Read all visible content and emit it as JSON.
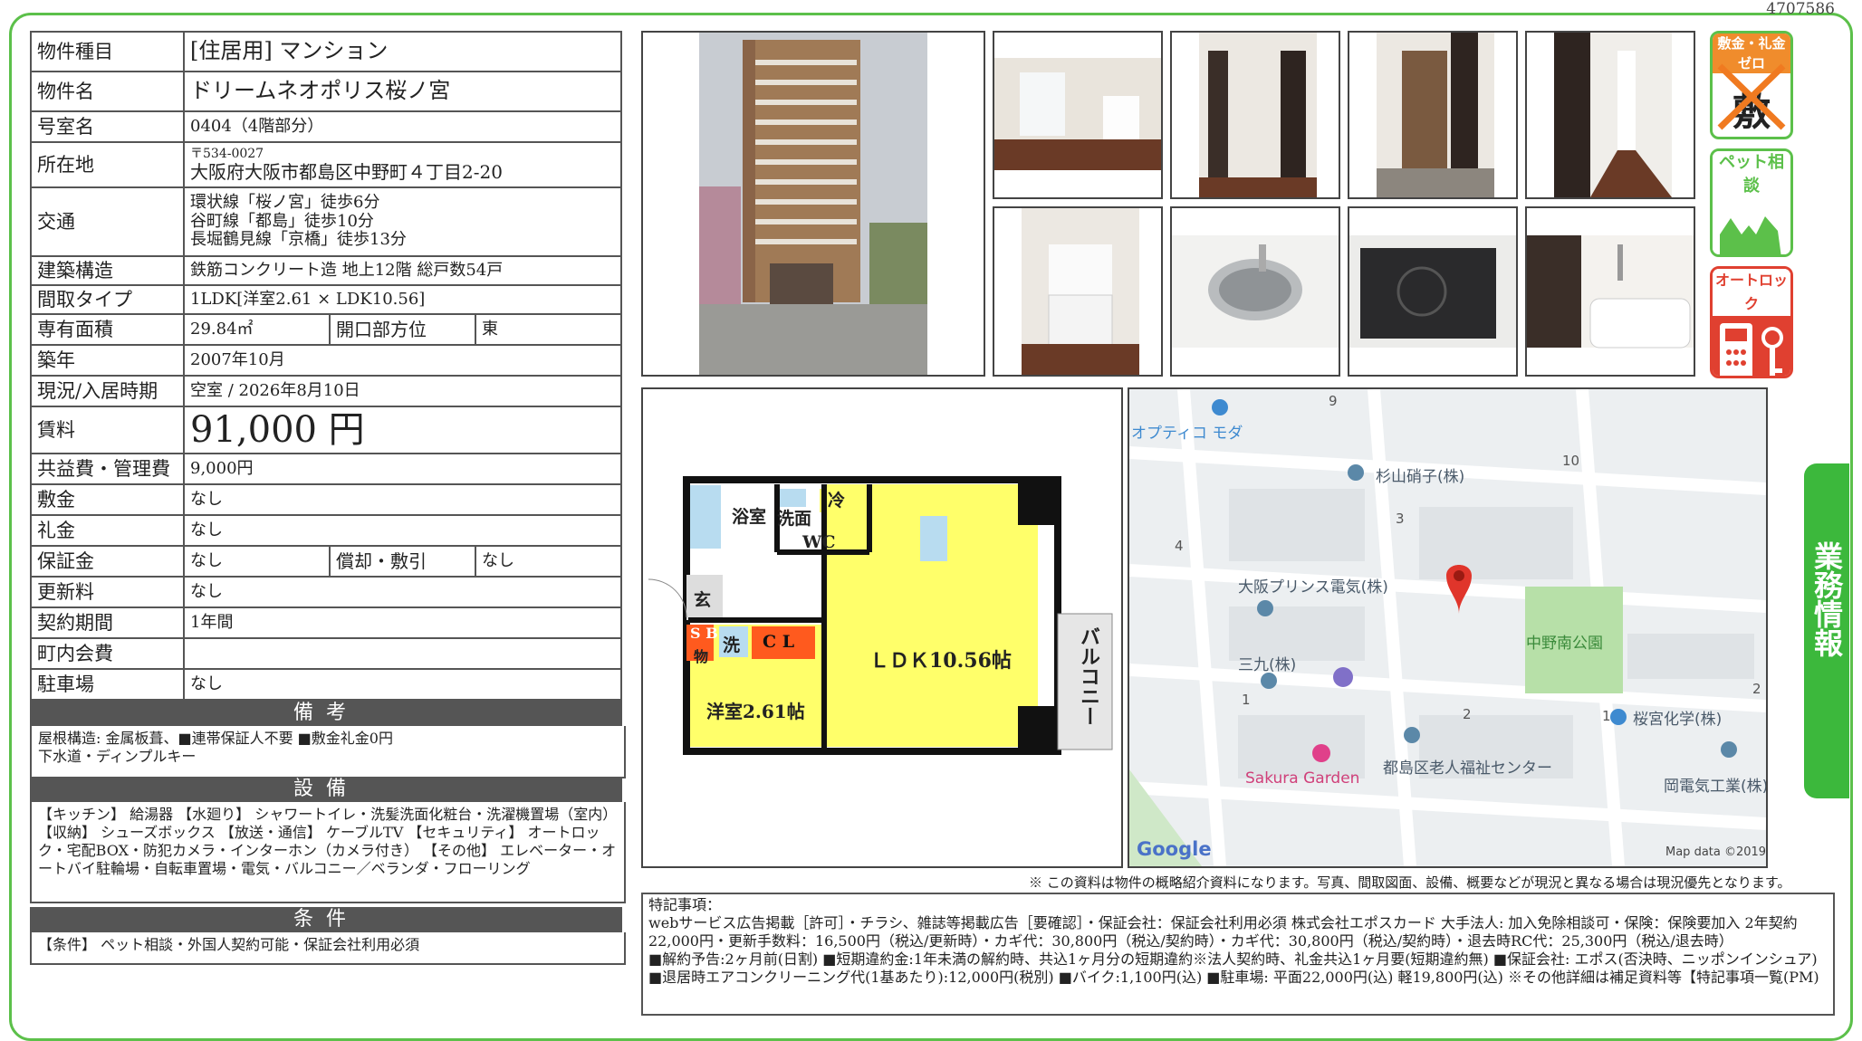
{
  "doc_id": "4707586",
  "spec": {
    "type_label": "物件種目",
    "type_value": "[住居用] マンション",
    "name_label": "物件名",
    "name_value": "ドリームネオポリス桜ノ宮",
    "room_label": "号室名",
    "room_value": "0404（4階部分）",
    "address_label": "所在地",
    "zip": "〒534-0027",
    "address": "大阪府大阪市都島区中野町４丁目2-20",
    "access_label": "交通",
    "access": [
      "環状線「桜ノ宮」徒歩6分",
      "谷町線「都島」徒歩10分",
      "長堀鶴見線「京橋」徒歩13分"
    ],
    "structure_label": "建築構造",
    "structure_value": "鉄筋コンクリート造 地上12階 総戸数54戸",
    "layout_label": "間取タイプ",
    "layout_value": "1LDK[洋室2.61 × LDK10.56]",
    "area_label": "専有面積",
    "area_value": "29.84㎡",
    "facing_label": "開口部方位",
    "facing_value": "東",
    "built_label": "築年",
    "built_value": "2007年10月",
    "status_label": "現況/入居時期",
    "status_value": "空室 / 2026年8月10日",
    "rent_label": "賃料",
    "rent_value": "91,000 円",
    "fee_label": "共益費・管理費",
    "fee_value": "9,000円",
    "deposit_label": "敷金",
    "deposit_value": "なし",
    "keymoney_label": "礼金",
    "keymoney_value": "なし",
    "guarantee_label": "保証金",
    "guarantee_value": "なし",
    "amort_label": "償却・敷引",
    "amort_value": "なし",
    "renewal_label": "更新料",
    "renewal_value": "なし",
    "term_label": "契約期間",
    "term_value": "1年間",
    "town_label": "町内会費",
    "town_value": "",
    "parking_label": "駐車場",
    "parking_value": "なし"
  },
  "remarks": {
    "title": "備考",
    "lines": [
      "屋根構造: 金属板葺、■連帯保証人不要 ■敷金礼金0円",
      "下水道・ディンプルキー"
    ]
  },
  "equipment": {
    "title": "設備",
    "text": "【キッチン】 給湯器 【水廻り】 シャワートイレ・洗髪洗面化粧台・洗濯機置場（室内） 【収納】 シューズボックス 【放送・通信】 ケーブルTV 【セキュリティ】 オートロック・宅配BOX・防犯カメラ・インターホン（カメラ付き） 【その他】 エレベーター・オートバイ駐輪場・自転車置場・電気・バルコニー／ベランダ・フローリング"
  },
  "conditions": {
    "title": "条件",
    "text": "【条件】 ペット相談・外国人契約可能・保証会社利用必須"
  },
  "badges": {
    "zero": "敷金・礼金ゼロ",
    "zero_chars": "敷 礼",
    "pet": "ペット相談",
    "autolock": "オートロック"
  },
  "floorplan": {
    "bath": "浴室",
    "wash": "洗面",
    "fridge": "冷",
    "wc": "WC",
    "entry": "玄",
    "sb1": "S B",
    "sb2": "物",
    "laundry": "洗",
    "closet": "C L",
    "ldk": "ＬＤＫ10.56帖",
    "western": "洋室2.61帖",
    "balcony": "バルコニー"
  },
  "map": {
    "labels": {
      "optico": "オプティコ モダ",
      "sugiyama": "杉山硝子(株)",
      "osaka_prince": "大阪プリンス電気(株)",
      "nakano_park": "中野南公園",
      "sankyu": "三九(株)",
      "sakuramiya": "桜宮化学(株)",
      "welfare": "都島区老人福祉センター",
      "sakura_garden": "Sakura Garden",
      "oka": "岡電気工業(株)",
      "google": "Google",
      "mapdata": "Map data ©2019"
    },
    "numbers": {
      "n9": "9",
      "n10": "10",
      "n3": "3",
      "n4": "4",
      "n1a": "1",
      "n2a": "2",
      "n1b": "1",
      "n2b": "2"
    }
  },
  "note": "※ この資料は物件の概略紹介資料になります。写真、間取図面、設備、概要などが現況と異なる場合は現況優先となります。",
  "special": {
    "title": "特記事項：",
    "text": "webサービス広告掲載［許可］・チラシ、雑誌等掲載広告［要確認］・保証会社：保証会社利用必須 株式会社エポスカード 大手法人: 加入免除相談可・保険：保険要加入 2年契約 22,000円・更新手数料：16,500円（税込/更新時）・カギ代：30,800円（税込/契約時）・カギ代：30,800円（税込/契約時）・退去時RC代：25,300円（税込/退去時）",
    "text2": "■解約予告:2ヶ月前(日割) ■短期違約金:1年未満の解約時、共込1ヶ月分の短期違約※法人契約時、礼金共込1ヶ月要(短期違約無) ■保証会社: エポス(否決時、ニッポンインシュア) ■退居時エアコンクリーニング代(1基あたり):12,000円(税別) ■バイク:1,100円(込) ■駐車場: 平面22,000円(込) 軽19,800円(込) ※その他詳細は補足資料等【特記事項一覧(PM)"
  },
  "side_tab": "業務情報"
}
